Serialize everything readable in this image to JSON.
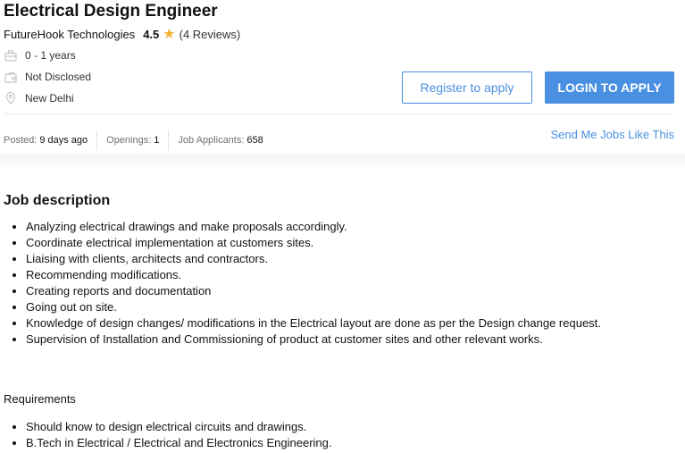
{
  "job": {
    "title": "Electrical Design Engineer",
    "company": "FutureHook Technologies",
    "rating": "4.5",
    "reviews": "(4 Reviews)",
    "experience": "0 - 1 years",
    "salary": "Not Disclosed",
    "location": "New Delhi"
  },
  "icons": {
    "experience": "briefcase-icon",
    "salary": "wallet-icon",
    "location": "location-pin-icon",
    "rating": "star-icon"
  },
  "actions": {
    "register_label": "Register to apply",
    "login_label": "LOGIN TO APPLY",
    "send_jobs_label": "Send Me Jobs Like This"
  },
  "stats": {
    "posted_label": "Posted:",
    "posted_value": "9 days ago",
    "openings_label": "Openings:",
    "openings_value": "1",
    "applicants_label": "Job Applicants:",
    "applicants_value": "658"
  },
  "description": {
    "heading": "Job description",
    "items": [
      "Analyzing electrical drawings and make proposals accordingly.",
      "Coordinate electrical implementation at customers sites.",
      "Liaising with clients, architects and contractors.",
      "Recommending modifications.",
      "Creating reports and documentation",
      "Going out on site.",
      "Knowledge of design changes/ modifications in the Electrical layout are done as per the Design change request.",
      "Supervision of Installation and Commissioning of product at customer sites and other relevant works."
    ],
    "requirements_label": "Requirements",
    "requirements": [
      "Should know to design electrical circuits and drawings.",
      "B.Tech in Electrical / Electrical and Electronics Engineering."
    ]
  },
  "colors": {
    "accent": "#4a90e2",
    "star": "#f5b335",
    "text": "#121212"
  }
}
